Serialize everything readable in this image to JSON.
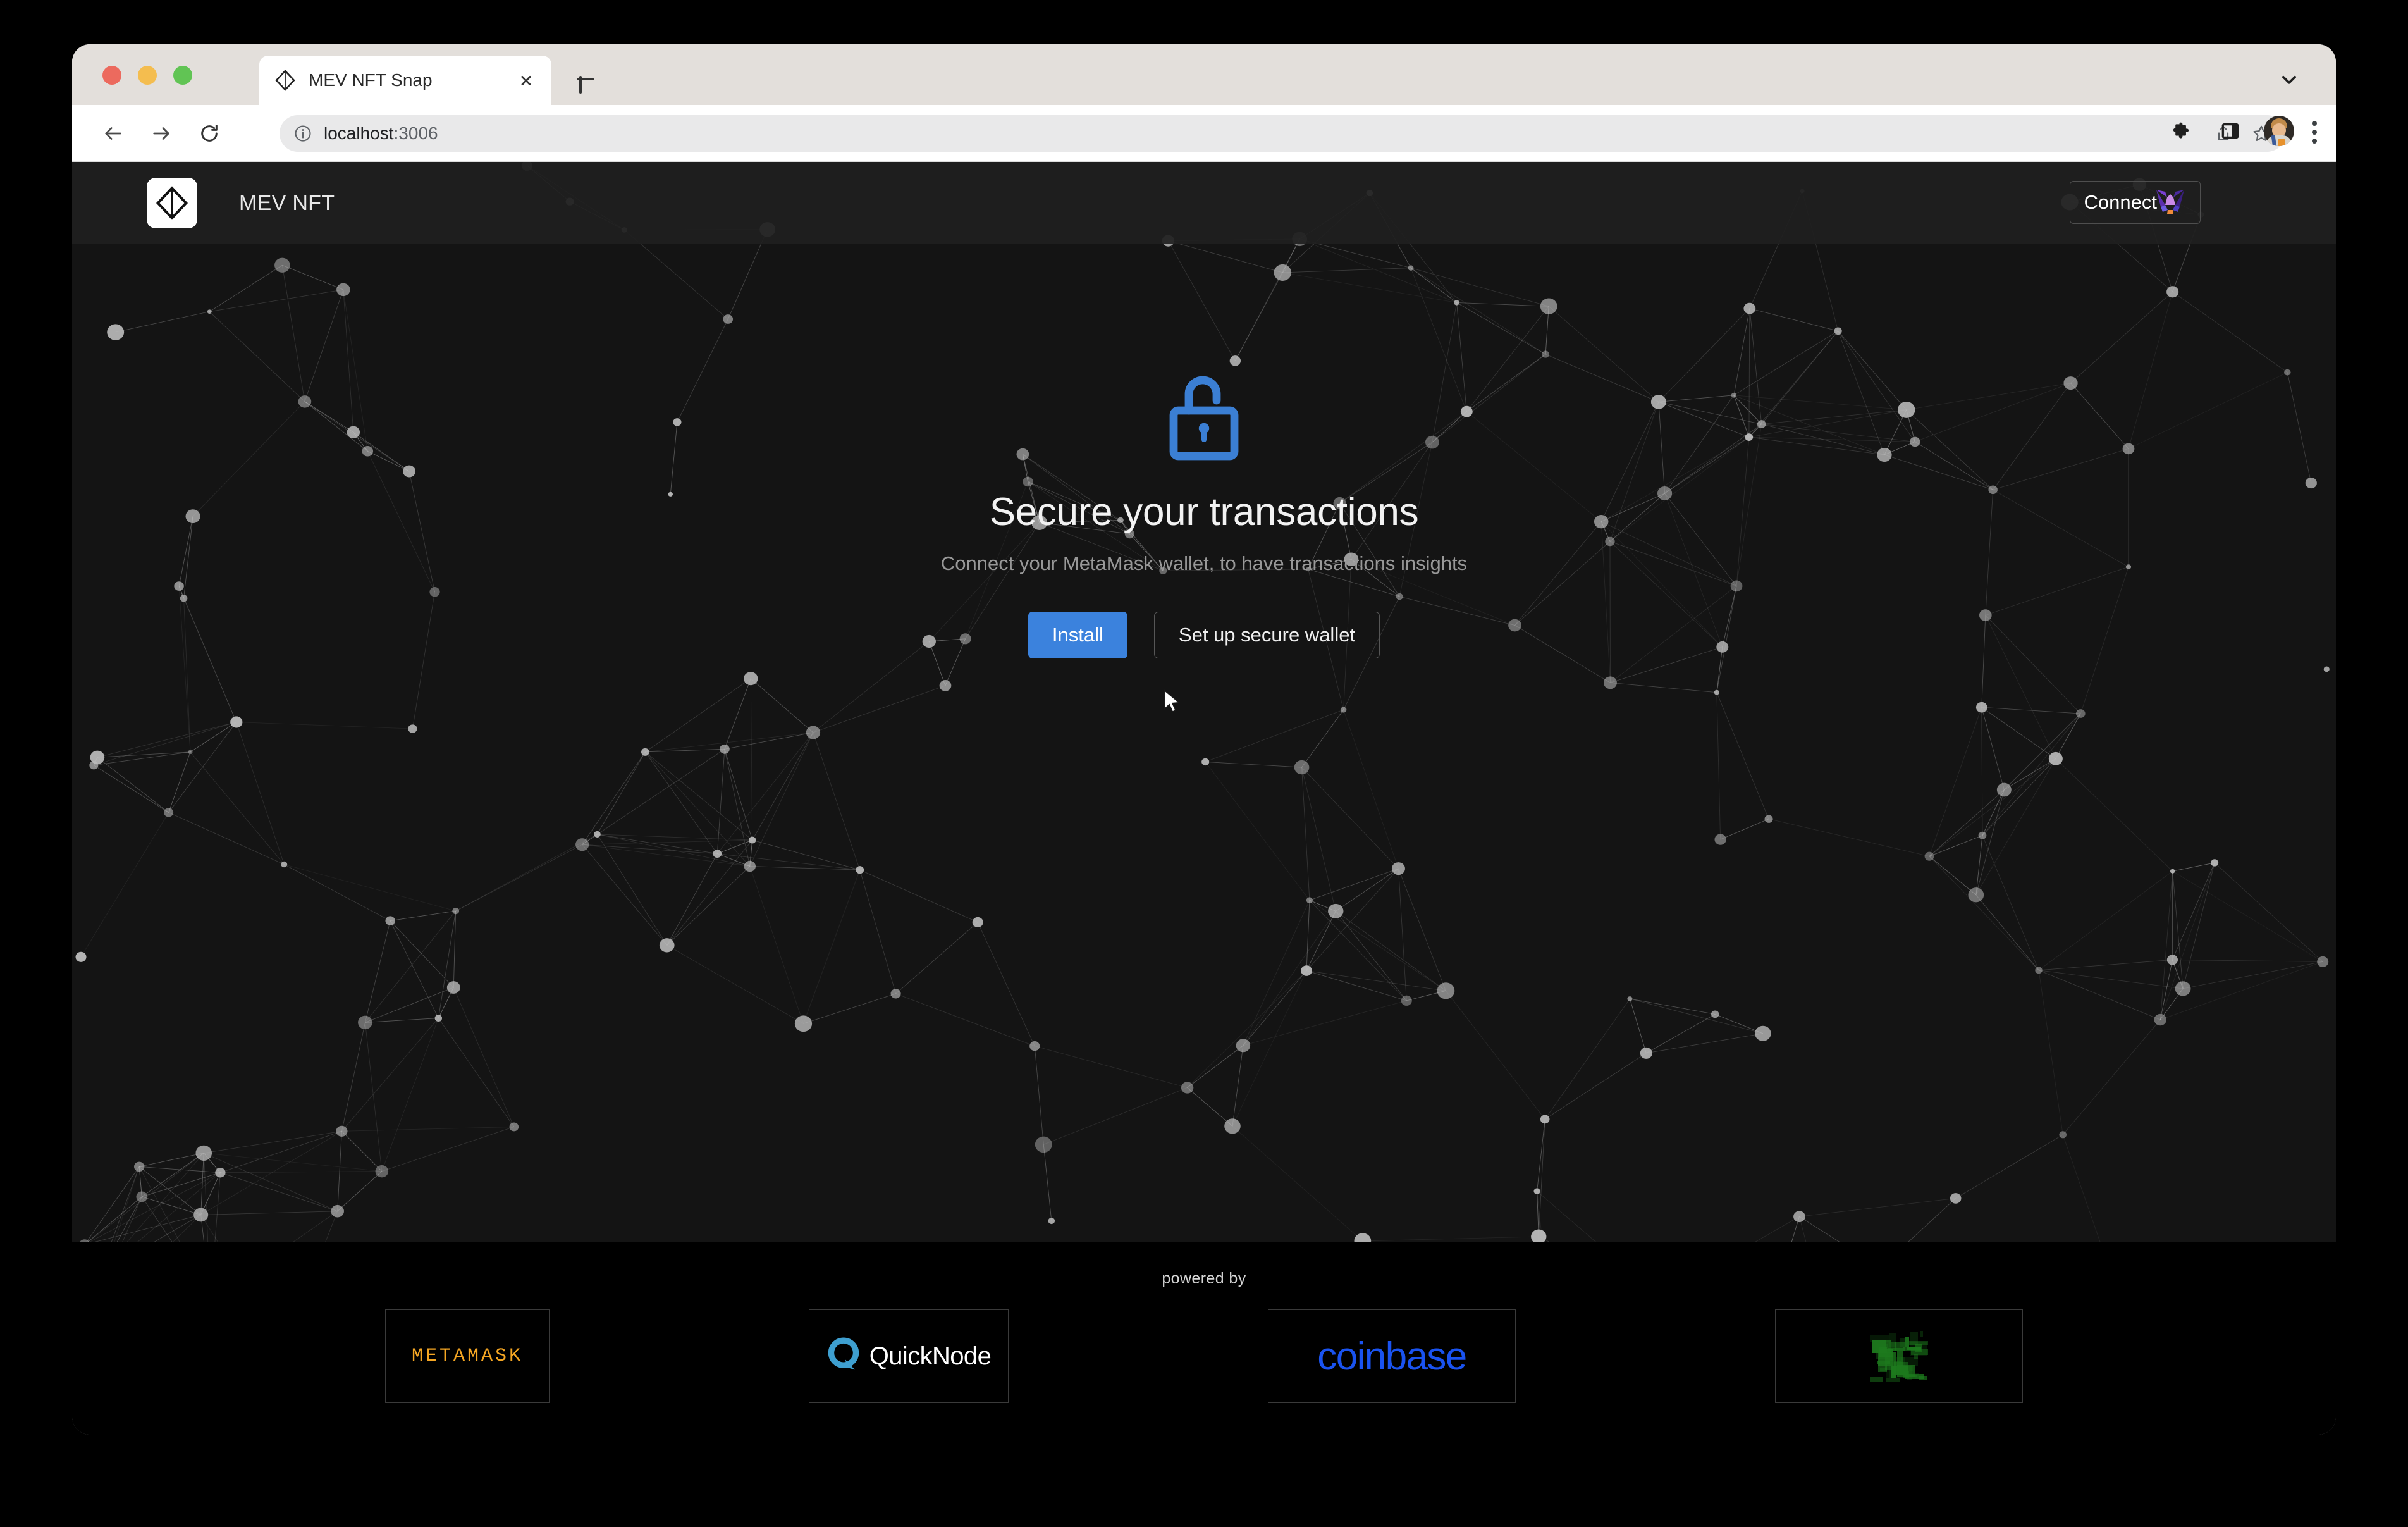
{
  "browser": {
    "traffic_lights": [
      "close",
      "minimize",
      "maximize"
    ],
    "tab": {
      "title": "MEV NFT Snap",
      "favicon": "diamond-icon",
      "close_label": "Close tab"
    },
    "new_tab_label": "New Tab",
    "tab_list_icon": "chevron-down-icon",
    "nav": {
      "back_icon": "arrow-left-icon",
      "forward_icon": "arrow-right-icon",
      "reload_icon": "reload-icon"
    },
    "omnibox": {
      "info_icon": "info-circle-icon",
      "url_host": "localhost",
      "url_port": ":3006",
      "share_icon": "share-icon",
      "bookmark_icon": "star-outline-icon"
    },
    "toolbar_right": {
      "extensions_icon": "puzzle-piece-icon",
      "side_panel_icon": "side-panel-icon",
      "avatar": "profile-avatar",
      "menu_icon": "three-dot-menu-icon"
    }
  },
  "site": {
    "header": {
      "logo_icon": "mev-diamond-logo",
      "brand": "MEV NFT",
      "connect_label": "Connect",
      "connect_icon": "metamask-fox-icon"
    },
    "hero": {
      "lock_icon": "unlocked-padlock-icon",
      "title": "Secure your transactions",
      "subtitle": "Connect your MetaMask wallet, to have transactions insights",
      "install_label": "Install",
      "setup_label": "Set up secure wallet"
    },
    "footer": {
      "powered_by": "powered by",
      "partners": [
        {
          "name": "METAMASK",
          "icon": "metamask-wordmark"
        },
        {
          "name": "QuickNode",
          "icon": "quicknode-q-logo"
        },
        {
          "name": "coinbase",
          "icon": "coinbase-wordmark"
        },
        {
          "name": "",
          "icon": "mev-glitch-logo"
        }
      ]
    }
  },
  "colors": {
    "accent_blue": "#3b82dd",
    "lock_blue": "#3b7fd4",
    "header_bg": "#1f1f1f",
    "page_bg": "#141414",
    "footer_bg": "#000000",
    "metamask_orange": "#f5a623",
    "quicknode_blue": "#3e9fd0",
    "coinbase_blue": "#1a53f0",
    "mev_green": "#1d7a1d"
  }
}
